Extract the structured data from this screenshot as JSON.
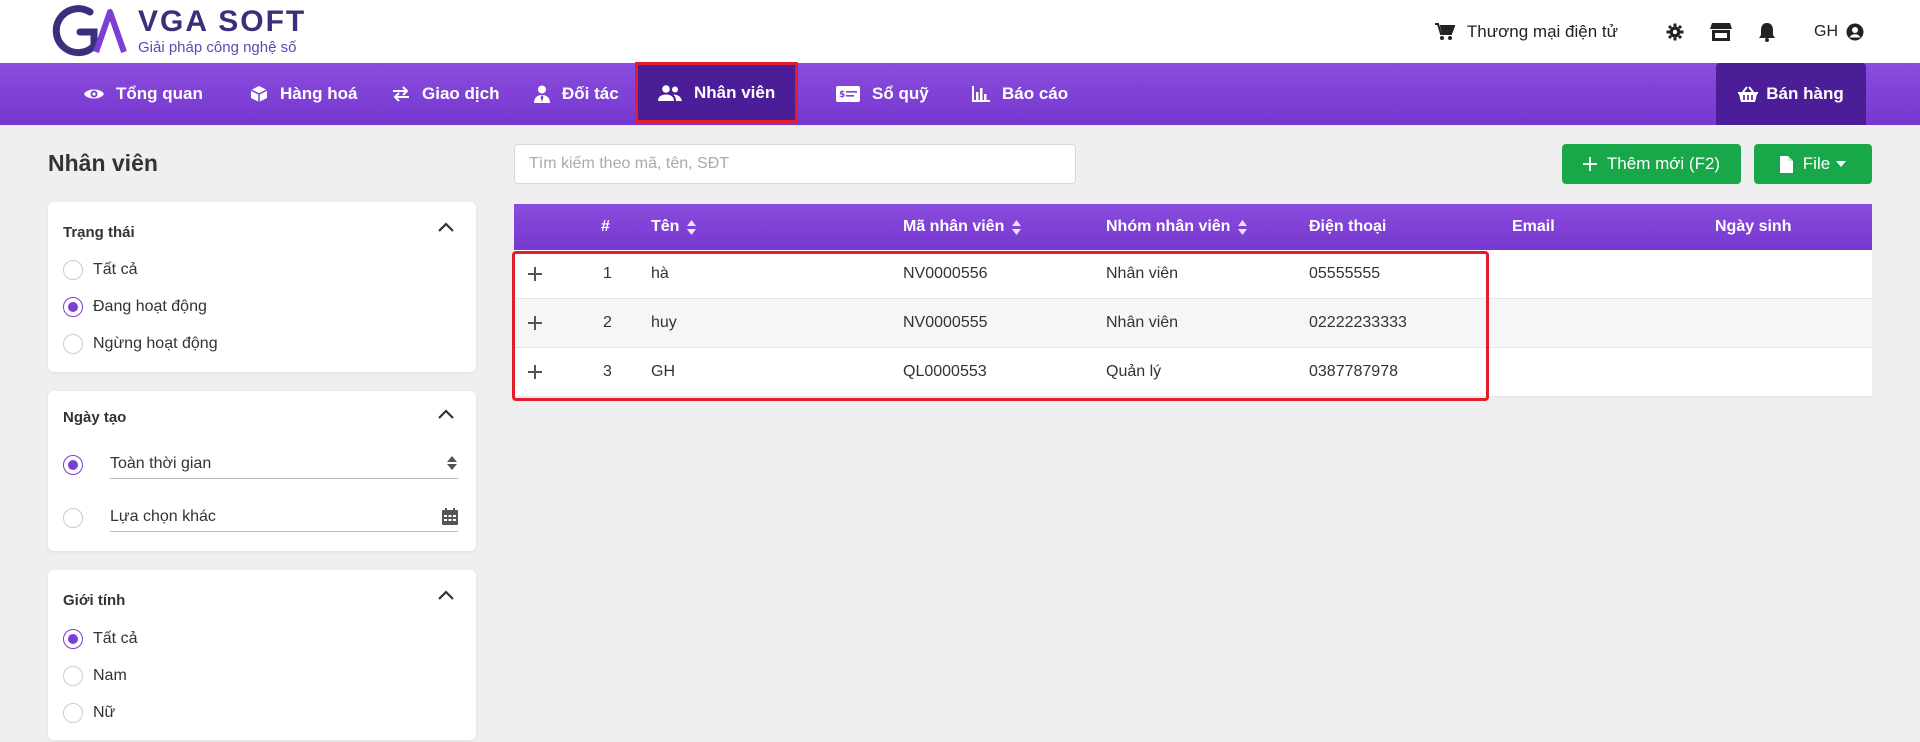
{
  "brand": {
    "name": "VGA SOFT",
    "slogan": "Giải pháp công nghệ số"
  },
  "topbar": {
    "ecommerce_label": "Thương mại điện tử",
    "user_initials": "GH"
  },
  "nav": {
    "items": [
      {
        "label": "Tổng quan",
        "icon": "eye-icon"
      },
      {
        "label": "Hàng hoá",
        "icon": "box-icon"
      },
      {
        "label": "Giao dịch",
        "icon": "exchange-icon"
      },
      {
        "label": "Đối tác",
        "icon": "user-tie-icon"
      },
      {
        "label": "Nhân viên",
        "icon": "users-icon",
        "active": true
      },
      {
        "label": "Sổ quỹ",
        "icon": "money-check-icon"
      },
      {
        "label": "Báo cáo",
        "icon": "bar-chart-icon"
      }
    ],
    "sell_label": "Bán hàng"
  },
  "page": {
    "title": "Nhân viên",
    "search_placeholder": "Tìm kiếm theo mã, tên, SĐT",
    "add_button": "Thêm mới (F2)",
    "file_button": "File"
  },
  "filters": {
    "status": {
      "title": "Trạng thái",
      "options": [
        "Tất cả",
        "Đang hoạt động",
        "Ngừng hoạt động"
      ],
      "selected": 1
    },
    "created": {
      "title": "Ngày tạo",
      "all_time": "Toàn thời gian",
      "custom": "Lựa chọn khác",
      "selected": 0
    },
    "gender": {
      "title": "Giới tính",
      "options": [
        "Tất cả",
        "Nam",
        "Nữ"
      ],
      "selected": 0
    }
  },
  "table": {
    "columns": [
      "#",
      "Tên",
      "Mã nhân viên",
      "Nhóm nhân viên",
      "Điện thoại",
      "Email",
      "Ngày sinh"
    ],
    "rows": [
      {
        "index": "1",
        "name": "hà",
        "code": "NV0000556",
        "group": "Nhân viên",
        "phone": "05555555",
        "email": "",
        "birthday": ""
      },
      {
        "index": "2",
        "name": "huy",
        "code": "NV0000555",
        "group": "Nhân viên",
        "phone": "02222233333",
        "email": "",
        "birthday": ""
      },
      {
        "index": "3",
        "name": "GH",
        "code": "QL0000553",
        "group": "Quản lý",
        "phone": "0387787978",
        "email": "",
        "birthday": ""
      }
    ]
  },
  "colors": {
    "primary": "#7a3fd4",
    "primary_dark": "#4b1d97",
    "green": "#18a84a",
    "highlight": "#e21d2c"
  }
}
